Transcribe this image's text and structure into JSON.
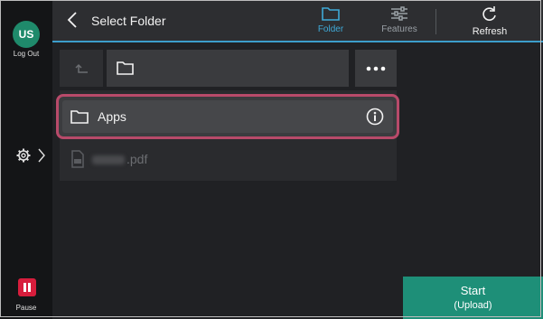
{
  "rail": {
    "avatar_initials": "US",
    "logout_label": "Log Out",
    "settings_icon": "gear-icon",
    "pause_label": "Pause",
    "pause_color": "#d71d3c"
  },
  "header": {
    "back_icon": "chevron-left-icon",
    "title": "Select Folder",
    "tabs": [
      {
        "label": "Folder",
        "icon": "folder-icon",
        "active": true
      },
      {
        "label": "Features",
        "icon": "sliders-icon",
        "active": false
      }
    ],
    "refresh_label": "Refresh",
    "accent_color": "#3faad8"
  },
  "path_bar": {
    "up_icon": "up-level-icon",
    "current_icon": "folder-icon",
    "more_icon": "more-icon"
  },
  "list": {
    "items": [
      {
        "label": "Apps",
        "icon": "folder-icon",
        "selected": true
      },
      {
        "label": ".pdf",
        "icon": "file-icon",
        "selected": false,
        "disabled": true
      }
    ]
  },
  "start": {
    "label": "Start",
    "sub_label": "(Upload)",
    "color": "#1e8f78"
  }
}
